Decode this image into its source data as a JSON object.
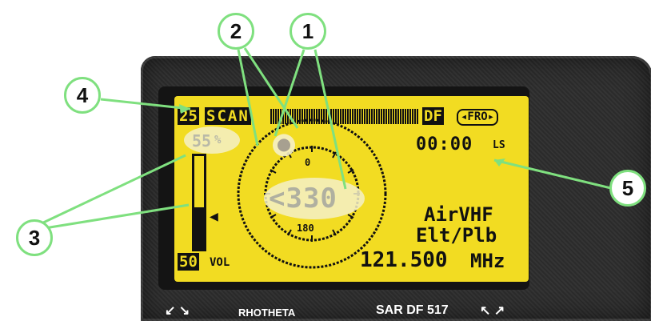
{
  "device": {
    "brand": "RHOTHETA",
    "model": "SAR DF 517"
  },
  "lcd": {
    "channel_number": "25",
    "scan_label": "SCAN",
    "df_label": "DF",
    "fro_label": "◂FRO▸",
    "squelch_value": "55",
    "squelch_suffix": "%",
    "timer": "00:00",
    "timer_unit": "LS",
    "bearing": "<330",
    "bearing_deg": 330,
    "compass_top": "0",
    "compass_bottom": "180",
    "band": "AirVHF",
    "mode": "Elt/Plb",
    "frequency": "121.500",
    "frequency_unit": "MHz",
    "volume_value": "50",
    "volume_label": "VOL",
    "signal_level_fraction": 0.45
  },
  "callouts": [
    "1",
    "2",
    "3",
    "4",
    "5"
  ],
  "colors": {
    "lcd_background": "#f2dc22",
    "lcd_ink": "#111111",
    "bezel": "#2d2d2d",
    "callout_line": "#7fe07f",
    "highlight": "#f5f0c8"
  }
}
